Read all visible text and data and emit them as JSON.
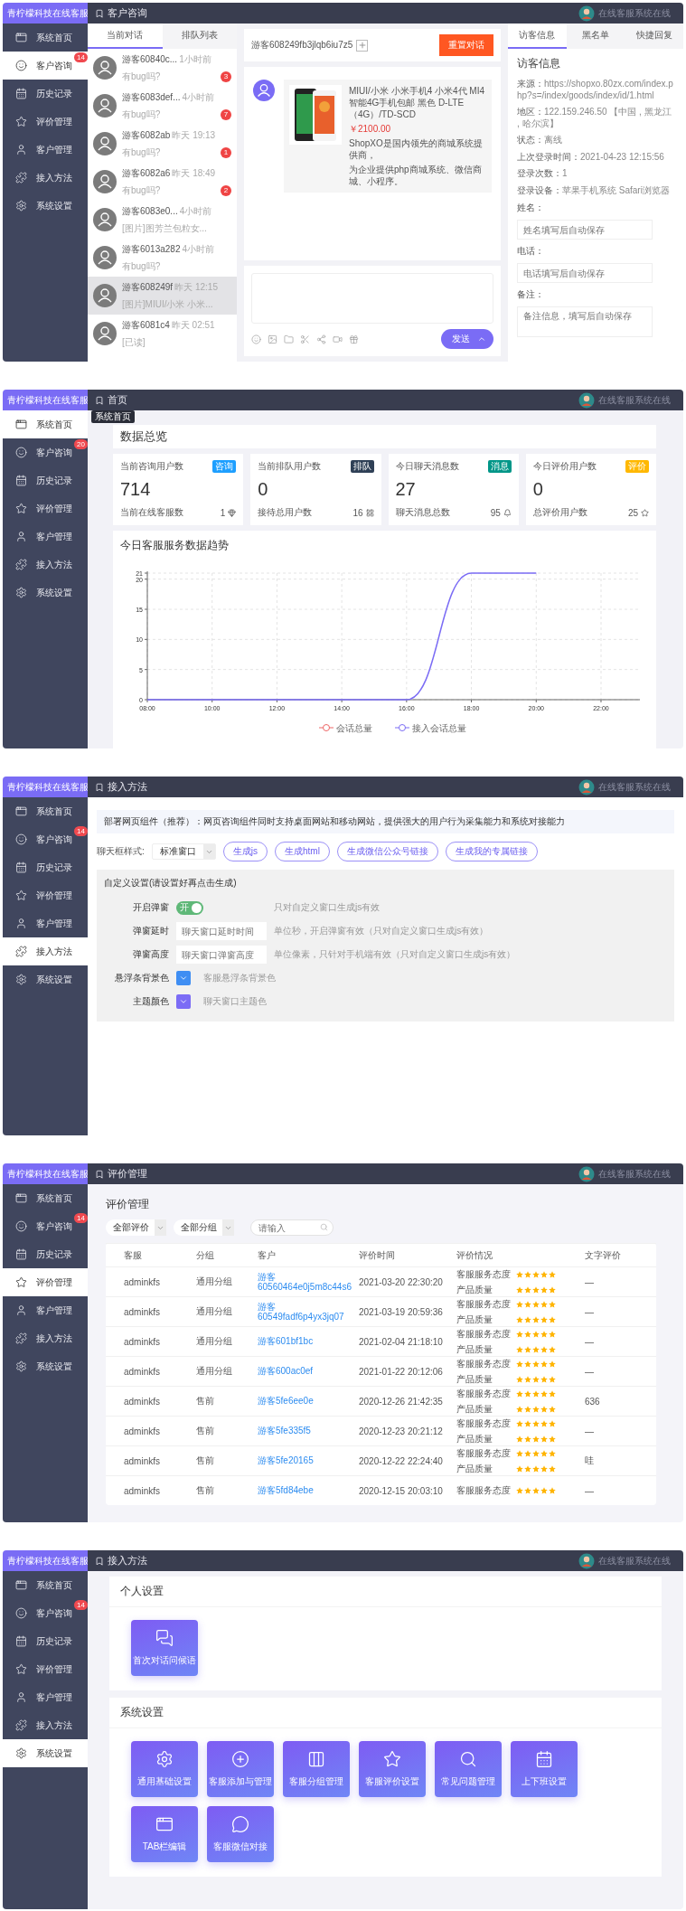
{
  "screens": [
    {
      "kind": "chat",
      "brand": "青柠檬科技在线客服",
      "title": "客户咨询",
      "status": "在线客服系统在线",
      "nav": [
        {
          "label": "系统首页",
          "selected": false
        },
        {
          "label": "客户咨询",
          "selected": true,
          "badge": "14"
        },
        {
          "label": "历史记录",
          "selected": false
        },
        {
          "label": "评价管理",
          "selected": false
        },
        {
          "label": "客户管理",
          "selected": false
        },
        {
          "label": "接入方法",
          "selected": false
        },
        {
          "label": "系统设置",
          "selected": false
        }
      ],
      "list_tabs": [
        {
          "label": "当前对话",
          "selected": true
        },
        {
          "label": "排队列表",
          "selected": false
        }
      ],
      "conversations": [
        {
          "name": "游客60840c...",
          "time": "1小时前",
          "preview": "有bug吗?",
          "unread": "3",
          "selected": false
        },
        {
          "name": "游客6083def...",
          "time": "4小时前",
          "preview": "有bug吗?",
          "unread": "7",
          "selected": false
        },
        {
          "name": "游客6082ab",
          "time": "昨天 19:13",
          "preview": "有bug吗?",
          "unread": "1",
          "selected": false
        },
        {
          "name": "游客6082a6",
          "time": "昨天 18:49",
          "preview": "有bug吗?",
          "unread": "2",
          "selected": false
        },
        {
          "name": "游客6083e0...",
          "time": "4小时前",
          "preview": "[图片]图芳兰包粒女...",
          "selected": false
        },
        {
          "name": "游客6013a282",
          "time": "4小时前",
          "preview": "有bug吗?",
          "selected": false
        },
        {
          "name": "游客608249f",
          "time": "昨天 12:15",
          "preview": "[图片]MIUI/小米 小米...",
          "selected": true
        },
        {
          "name": "游客6081c4",
          "time": "昨天 02:51",
          "preview": "[已读]",
          "selected": false
        }
      ],
      "chat": {
        "visitor": "游客608249fb3jlqb6iu7z5",
        "reset_button": "重置对话",
        "product": {
          "title": "MIUI/小米 小米手机4 小米4代 MI4智能4G手机包邮 黑色 D-LTE（4G）/TD-SCD",
          "price": "￥2100.00",
          "description": [
            "ShopXO是国内领先的商城系统提供商，",
            "为企业提供php商城系统、微信商城、小程序。"
          ]
        },
        "send_button": "发送"
      },
      "info_tabs": [
        {
          "label": "访客信息",
          "selected": true
        },
        {
          "label": "黑名单",
          "selected": false
        },
        {
          "label": "快捷回复",
          "selected": false
        }
      ],
      "info": {
        "heading": "访客信息",
        "facts": [
          {
            "label": "来源：",
            "value": "https://shopxo.80zx.com/index.php?s=/index/goods/index/id/1.html"
          },
          {
            "label": "地区：",
            "value": "122.159.246.50 【中国 , 黑龙江 , 哈尔滨】"
          },
          {
            "label": "状态：",
            "value": "离线"
          },
          {
            "label": "上次登录时间：",
            "value": "2021-04-23 12:15:56"
          },
          {
            "label": "登录次数：",
            "value": "1"
          },
          {
            "label": "登录设备：",
            "value": "苹果手机系统 Safari浏览器"
          }
        ],
        "fields": [
          {
            "kind": "input",
            "label": "姓名：",
            "placeholder": "姓名填写后自动保存"
          },
          {
            "kind": "input",
            "label": "电话：",
            "placeholder": "电话填写后自动保存"
          },
          {
            "kind": "textarea",
            "label": "备注：",
            "placeholder": "备注信息，填写后自动保存"
          }
        ]
      }
    },
    {
      "kind": "dashboard",
      "brand": "青柠檬科技在线客服",
      "title": "首页",
      "status": "在线客服系统在线",
      "tooltip": "系统首页",
      "nav": [
        {
          "label": "系统首页",
          "selected": true
        },
        {
          "label": "客户咨询",
          "selected": false,
          "badge": "20"
        },
        {
          "label": "历史记录",
          "selected": false
        },
        {
          "label": "评价管理",
          "selected": false
        },
        {
          "label": "客户管理",
          "selected": false
        },
        {
          "label": "接入方法",
          "selected": false
        },
        {
          "label": "系统设置",
          "selected": false
        }
      ],
      "overview_title": "数据总览",
      "stats": [
        {
          "label": "当前咨询用户数",
          "tag": "咨询",
          "color": "#1e9fff",
          "value": "714",
          "sub_label": "当前在线客服数",
          "sub_value": "1"
        },
        {
          "label": "当前排队用户数",
          "tag": "排队",
          "color": "#2f4056",
          "value": "0",
          "sub_label": "接待总用户数",
          "sub_value": "16"
        },
        {
          "label": "今日聊天消息数",
          "tag": "消息",
          "color": "#009688",
          "value": "27",
          "sub_label": "聊天消息总数",
          "sub_value": "95"
        },
        {
          "label": "今日评价用户数",
          "tag": "评价",
          "color": "#ffb800",
          "value": "0",
          "sub_label": "总评价用户数",
          "sub_value": "25"
        }
      ],
      "chart": {
        "title": "今日客服服务数据趋势",
        "chart_data": {
          "type": "line",
          "categories": [
            "08:00",
            "10:00",
            "12:00",
            "14:00",
            "16:00",
            "18:00",
            "20:00",
            "22:00"
          ],
          "series": [
            {
              "name": "会话总量",
              "color": "#ee6666",
              "values": [
                null,
                null,
                null,
                null,
                null,
                null,
                null,
                null
              ]
            },
            {
              "name": "接入会话总量",
              "color": "#7b6cf5",
              "values": [
                0,
                0,
                0,
                0,
                0,
                21,
                21,
                null
              ]
            }
          ],
          "ylim": [
            0,
            21
          ],
          "yticks": [
            0,
            5,
            10,
            15,
            20,
            21
          ],
          "grid": true,
          "legend": "bottom"
        }
      }
    },
    {
      "kind": "embed",
      "brand": "青柠檬科技在线客服",
      "title": "接入方法",
      "status": "在线客服系统在线",
      "nav": [
        {
          "label": "系统首页",
          "selected": false
        },
        {
          "label": "客户咨询",
          "selected": false,
          "badge": "14"
        },
        {
          "label": "历史记录",
          "selected": false
        },
        {
          "label": "评价管理",
          "selected": false
        },
        {
          "label": "客户管理",
          "selected": false
        },
        {
          "label": "接入方法",
          "selected": true
        },
        {
          "label": "系统设置",
          "selected": false
        }
      ],
      "notice": "部署网页组件（推荐）：网页咨询组件同时支持桌面网站和移动网站，提供强大的用户行为采集能力和系统对接能力",
      "style_label": "聊天框样式:",
      "style_value": "标准窗口",
      "buttons": [
        "生成js",
        "生成html",
        "生成微信公众号链接",
        "生成我的专属链接"
      ],
      "custom": {
        "title": "自定义设置(请设置好再点击生成)",
        "rows": [
          {
            "kind": "switch",
            "label": "开启弹窗",
            "on": true,
            "switch_text": "开",
            "hint": "只对自定义窗口生成js有效"
          },
          {
            "kind": "input",
            "label": "弹窗延时",
            "placeholder": "聊天窗口延时时间",
            "hint": "单位秒，开启弹窗有效（只对自定义窗口生成js有效）"
          },
          {
            "kind": "input",
            "label": "弹窗高度",
            "placeholder": "聊天窗口弹窗高度",
            "hint": "单位像素，只针对手机端有效（只对自定义窗口生成js有效）"
          },
          {
            "kind": "color",
            "label": "悬浮条背景色",
            "color": "#3f8ef3",
            "hint": "客服悬浮条背景色"
          },
          {
            "kind": "color",
            "label": "主题颜色",
            "color": "#7b6cf5",
            "hint": "聊天窗口主题色"
          }
        ]
      }
    },
    {
      "kind": "reviews",
      "brand": "青柠檬科技在线客服",
      "title": "评价管理",
      "status": "在线客服系统在线",
      "nav": [
        {
          "label": "系统首页",
          "selected": false
        },
        {
          "label": "客户咨询",
          "selected": false,
          "badge": "14"
        },
        {
          "label": "历史记录",
          "selected": false
        },
        {
          "label": "评价管理",
          "selected": true
        },
        {
          "label": "客户管理",
          "selected": false
        },
        {
          "label": "接入方法",
          "selected": false
        },
        {
          "label": "系统设置",
          "selected": false
        }
      ],
      "heading": "评价管理",
      "filters": [
        "全部评价",
        "全部分组"
      ],
      "search": {
        "placeholder": "请输入"
      },
      "columns": [
        "客服",
        "分组",
        "客户",
        "评价时间",
        "评价情况",
        "文字评价"
      ],
      "rows": [
        {
          "agent": "adminkfs",
          "group": "通用分组",
          "customer": "游客60560464e0j5m8c44s6",
          "time": "2021-03-20 22:30:20",
          "ratings": [
            {
              "label": "客服服务态度",
              "stars": 5
            },
            {
              "label": "产品质量",
              "stars": 5
            }
          ],
          "comment": "—"
        },
        {
          "agent": "adminkfs",
          "group": "通用分组",
          "customer": "游客60549fadf6p4yx3jq07",
          "time": "2021-03-19 20:59:36",
          "ratings": [
            {
              "label": "客服服务态度",
              "stars": 5
            },
            {
              "label": "产品质量",
              "stars": 5
            }
          ],
          "comment": "—"
        },
        {
          "agent": "adminkfs",
          "group": "通用分组",
          "customer": "游客601bf1bc",
          "time": "2021-02-04 21:18:10",
          "ratings": [
            {
              "label": "客服服务态度",
              "stars": 5
            },
            {
              "label": "产品质量",
              "stars": 5
            }
          ],
          "comment": "—"
        },
        {
          "agent": "adminkfs",
          "group": "通用分组",
          "customer": "游客600ac0ef",
          "time": "2021-01-22 20:12:06",
          "ratings": [
            {
              "label": "客服服务态度",
              "stars": 5
            },
            {
              "label": "产品质量",
              "stars": 5
            }
          ],
          "comment": "—"
        },
        {
          "agent": "adminkfs",
          "group": "售前",
          "customer": "游客5fe6ee0e",
          "time": "2020-12-26 21:42:35",
          "ratings": [
            {
              "label": "客服服务态度",
              "stars": 5
            },
            {
              "label": "产品质量",
              "stars": 5
            }
          ],
          "comment": "636"
        },
        {
          "agent": "adminkfs",
          "group": "售前",
          "customer": "游客5fe335f5",
          "time": "2020-12-23 20:21:12",
          "ratings": [
            {
              "label": "客服服务态度",
              "stars": 5
            },
            {
              "label": "产品质量",
              "stars": 5
            }
          ],
          "comment": "—"
        },
        {
          "agent": "adminkfs",
          "group": "售前",
          "customer": "游客5fe20165",
          "time": "2020-12-22 22:24:40",
          "ratings": [
            {
              "label": "客服服务态度",
              "stars": 5
            },
            {
              "label": "产品质量",
              "stars": 5
            }
          ],
          "comment": "哇"
        },
        {
          "agent": "adminkfs",
          "group": "售前",
          "customer": "游客5fd84ebe",
          "time": "2020-12-15 20:03:10",
          "ratings": [
            {
              "label": "客服服务态度",
              "stars": 5
            }
          ],
          "comment": "—"
        }
      ]
    },
    {
      "kind": "settings",
      "brand": "青柠檬科技在线客服",
      "title": "接入方法",
      "status": "在线客服系统在线",
      "nav": [
        {
          "label": "系统首页",
          "selected": false
        },
        {
          "label": "客户咨询",
          "selected": false,
          "badge": "14"
        },
        {
          "label": "历史记录",
          "selected": false
        },
        {
          "label": "评价管理",
          "selected": false
        },
        {
          "label": "客户管理",
          "selected": false
        },
        {
          "label": "接入方法",
          "selected": false
        },
        {
          "label": "系统设置",
          "selected": true
        }
      ],
      "sections": [
        {
          "title": "个人设置",
          "tiles": [
            "首次对话问候语"
          ]
        },
        {
          "title": "系统设置",
          "tiles": [
            "通用基础设置",
            "客服添加与管理",
            "客服分组管理",
            "客服评价设置",
            "常见问题管理",
            "上下班设置",
            "TAB栏编辑",
            "客服微信对接"
          ]
        }
      ]
    }
  ]
}
